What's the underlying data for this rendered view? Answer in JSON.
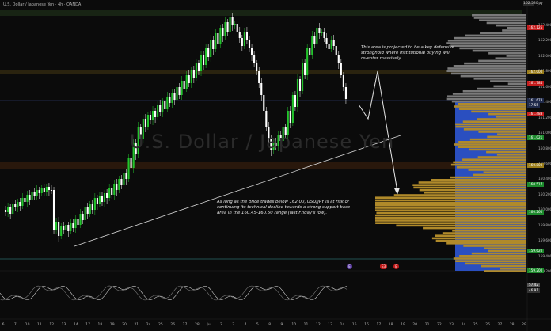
{
  "header": {
    "title": "U.S. Dollar / Japanese Yen · 4h · OANDA",
    "jpy": "JPY",
    "top_badge": "162.580"
  },
  "watermark": "U.S. Dollar / Japanese Yen",
  "annotations": {
    "top": "This area is projected to be a key defensive stronghold where institutional buying will re-enter massively.",
    "bottom": "As long as the price trades below 162.00, USD/JPY is at risk of continuing its technical decline towards a strong support base area in the 160.45-160.50 range (last Friday's low)."
  },
  "price_axis": {
    "labels": [
      "162.400",
      "162.200",
      "162.000",
      "161.800",
      "161.600",
      "161.400",
      "161.200",
      "161.000",
      "160.800",
      "160.600",
      "160.400",
      "160.200",
      "160.000",
      "159.800",
      "159.600",
      "159.400",
      "159.200"
    ],
    "tags": [
      {
        "text": "162.125",
        "color": "#c41c1c"
      },
      {
        "text": "162.000",
        "color": "#9a7d1a"
      },
      {
        "text": "161.784",
        "color": "#c41c1c"
      },
      {
        "text": "161.678",
        "color": "#202a4a"
      },
      {
        "text": "17:55",
        "color": "#202a4a"
      },
      {
        "text": "161.483",
        "color": "#c41c1c"
      },
      {
        "text": "161.021",
        "color": "#1c8a2c"
      },
      {
        "text": "160.800",
        "color": "#9a7d1a"
      },
      {
        "text": "160.517",
        "color": "#1c8a2c"
      },
      {
        "text": "160.260",
        "color": "#1c8a2c"
      },
      {
        "text": "159.620",
        "color": "#1c8a2c"
      },
      {
        "text": "159.200",
        "color": "#1c8a2c"
      }
    ]
  },
  "time_axis": {
    "labels": [
      "6",
      "7",
      "10",
      "11",
      "12",
      "13",
      "14",
      "17",
      "18",
      "19",
      "20",
      "21",
      "24",
      "25",
      "26",
      "27",
      "28",
      "Jul",
      "2",
      "3",
      "4",
      "5",
      "8",
      "9",
      "10",
      "11",
      "12",
      "13",
      "14",
      "15",
      "16",
      "17",
      "18",
      "19",
      "20",
      "21",
      "22",
      "23",
      "24",
      "25",
      "26",
      "27",
      "28",
      "29"
    ]
  },
  "events": [
    "E",
    "E3",
    "E"
  ],
  "oscillator_tags": [
    "57.42",
    "46.91"
  ],
  "colors": {
    "bull": "#22c52c",
    "bear": "#ffffff",
    "resistance_band": "#3a3a20",
    "support_band": "#2a1a10",
    "profile_gray": "#7a7a7a",
    "profile_gold": "#b08a2a",
    "profile_blue": "#2a4fc0",
    "trendline": "#e0e0e0"
  }
}
